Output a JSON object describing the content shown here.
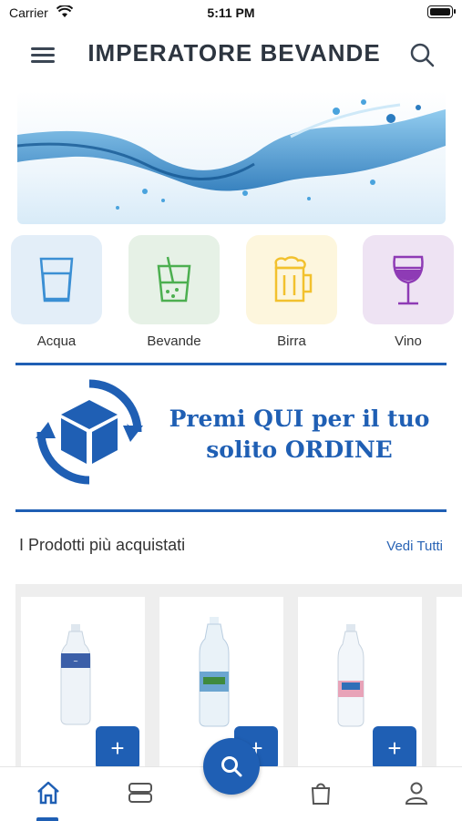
{
  "status_bar": {
    "carrier": "Carrier",
    "time": "5:11 PM"
  },
  "header": {
    "title": "IMPERATORE BEVANDE",
    "menu_icon": "hamburger-menu-icon",
    "search_icon": "search-icon"
  },
  "categories": [
    {
      "label": "Acqua",
      "icon": "water-glass-icon",
      "bg": "#e3eef8",
      "color": "#3b8fd4"
    },
    {
      "label": "Bevande",
      "icon": "soft-drink-icon",
      "bg": "#e6f1e6",
      "color": "#4caf50"
    },
    {
      "label": "Birra",
      "icon": "beer-mug-icon",
      "bg": "#fdf6dd",
      "color": "#f2c12e"
    },
    {
      "label": "Vino",
      "icon": "wine-glass-icon",
      "bg": "#eee3f3",
      "color": "#8e3bb5"
    }
  ],
  "order_banner": {
    "line1": "Premi QUI per il tuo",
    "line2": "solito ORDINE",
    "icon": "reorder-box-icon",
    "color": "#1f5fb4"
  },
  "products_section": {
    "title": "I Prodotti più acquistati",
    "see_all": "Vedi Tutti"
  },
  "products": [
    {
      "image": "water-bottle-image",
      "add_label": "+"
    },
    {
      "image": "water-bottle-image",
      "add_label": "+"
    },
    {
      "image": "water-bottle-image",
      "add_label": "+"
    }
  ],
  "tab_bar": {
    "items": [
      {
        "name": "home",
        "icon": "home-icon",
        "active": true
      },
      {
        "name": "categories",
        "icon": "stack-icon",
        "active": false
      },
      {
        "name": "cart",
        "icon": "shopping-bag-icon",
        "active": false
      },
      {
        "name": "profile",
        "icon": "user-icon",
        "active": false
      }
    ],
    "fab_icon": "search-icon"
  },
  "colors": {
    "primary": "#1f5fb4",
    "title": "#2d3540"
  }
}
